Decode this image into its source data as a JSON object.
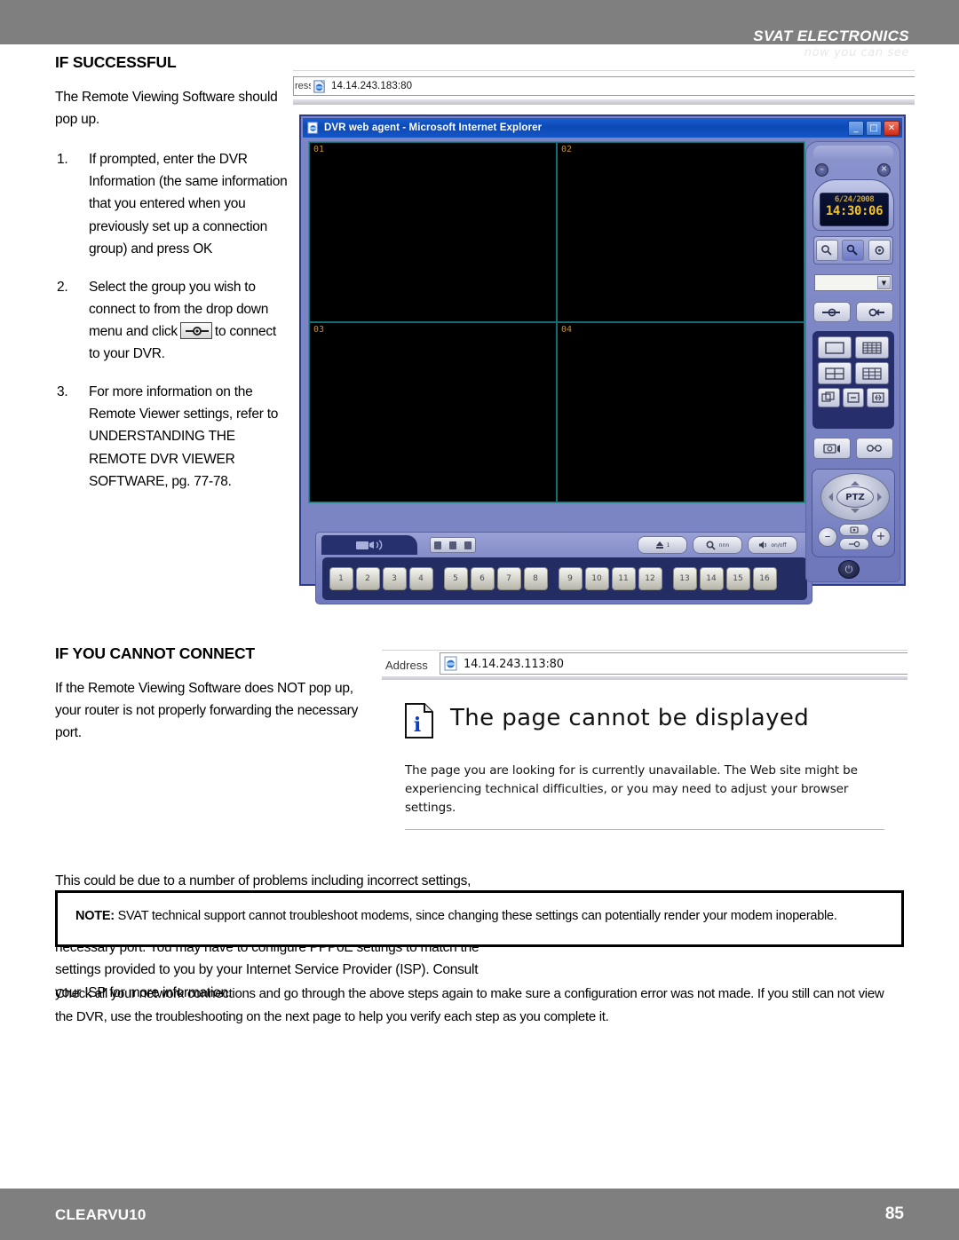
{
  "header": {
    "brand_name": "SVAT ELECTRONICS",
    "brand_tagline": "now you can see"
  },
  "section_success": {
    "heading": "IF SUCCESSFUL",
    "intro": "The Remote Viewing Software should pop up.",
    "steps": [
      {
        "num": "1.",
        "text": "If prompted, enter the DVR Information (the same information that you entered when you previously set up a connection group) and press OK"
      },
      {
        "num": "2.",
        "text_before": "Select the group you wish to connect to from the drop down menu and click",
        "icon": "connect-button-icon",
        "text_after": "to connect to your DVR."
      },
      {
        "num": "3.",
        "text": "For more information on the Remote Viewer settings, refer to UNDERSTANDING THE REMOTE DVR VIEWER SOFTWARE, pg. 77-78."
      }
    ]
  },
  "ie_top": {
    "address_label_clip": "ress",
    "url": "14.14.243.183:80",
    "icon": "ie-page-icon"
  },
  "dvr_window": {
    "title": "DVR web agent - Microsoft Internet Explorer",
    "app_icon": "ie-app-icon",
    "window_buttons": {
      "minimize": "_",
      "maximize": "□",
      "close": "✕"
    },
    "channels": [
      "01",
      "02",
      "03",
      "04"
    ],
    "channel_buttons": [
      "1",
      "2",
      "3",
      "4",
      "5",
      "6",
      "7",
      "8",
      "9",
      "10",
      "11",
      "12",
      "13",
      "14",
      "15",
      "16"
    ],
    "panel": {
      "date": "6/24/2008",
      "time": "14:30:06",
      "group_select_value": "",
      "dropdown_arrow": "▼",
      "ptz_label": "PTZ",
      "zoom_out": "–",
      "zoom_in": "+",
      "power_glyph": "⏻",
      "minimize_glyph": "–",
      "close_glyph": "✕"
    },
    "toolbar_buttons": [
      "alarm-button",
      "search-button",
      "audio-button"
    ]
  },
  "section_cannot_connect": {
    "heading": "IF YOU CANNOT CONNECT",
    "para1": "If the Remote Viewing Software does NOT pop up, your router is not properly forwarding the necessary port.",
    "para2": "This could be due to a number of problems including incorrect settings, presence of a firewall, or a DSL modem that has its own IP address. If your DSL modem has its own internal IP address, it will not properly forward the necessary port. You may have to configure PPPoE settings to match the settings provided to you by your Internet Service Provider (ISP). Consult your ISP for more information."
  },
  "ie_error": {
    "address_label": "Address",
    "url": "14.14.243.113:80",
    "icon": "ie-page-icon",
    "doc_icon": "info-document-icon",
    "title": "The page cannot be displayed",
    "body": "The page you are looking for is currently unavailable. The Web site might be experiencing technical difficulties, or you may need to adjust your browser settings."
  },
  "note": {
    "label": "NOTE:",
    "text": " SVAT technical support cannot troubleshoot modems, since changing these settings can potentially render your modem inoperable."
  },
  "closing_paragraph": "Check all your network connections and go through the above steps again to make sure a configuration error was not made.  If you still can not view the DVR, use the troubleshooting on the next page to help you verify each step as you complete it.",
  "footer": {
    "model": "CLEARVU10",
    "page_number": "85"
  }
}
